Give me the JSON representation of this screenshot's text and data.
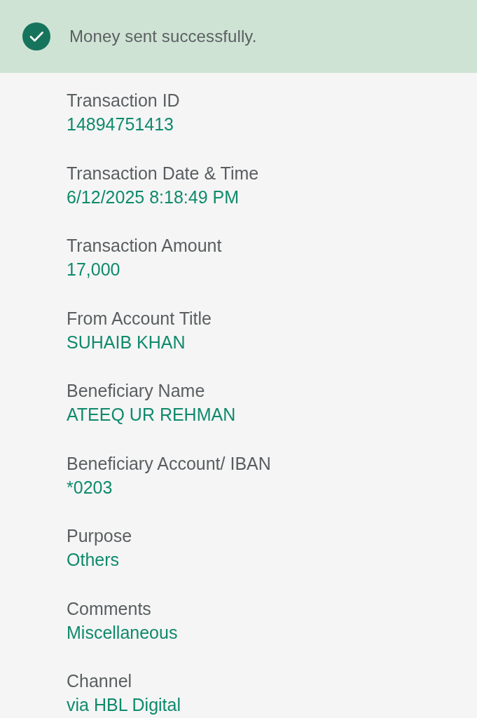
{
  "banner": {
    "message": "Money sent successfully."
  },
  "fields": [
    {
      "label": "Transaction ID",
      "value": "14894751413"
    },
    {
      "label": "Transaction Date & Time",
      "value": "6/12/2025 8:18:49 PM"
    },
    {
      "label": "Transaction Amount",
      "value": "17,000"
    },
    {
      "label": "From Account Title",
      "value": "SUHAIB KHAN"
    },
    {
      "label": "Beneficiary Name",
      "value": "ATEEQ UR REHMAN"
    },
    {
      "label": "Beneficiary Account/ IBAN",
      "value": "*0203"
    },
    {
      "label": "Purpose",
      "value": "Others"
    },
    {
      "label": "Comments",
      "value": "Miscellaneous"
    },
    {
      "label": "Channel",
      "value": "via HBL Digital"
    }
  ]
}
